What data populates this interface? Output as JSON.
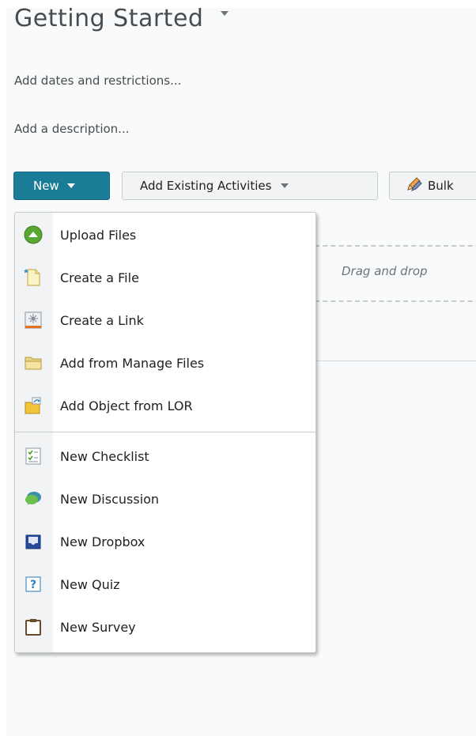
{
  "header": {
    "title": "Getting Started",
    "add_dates_link": "Add dates and restrictions...",
    "add_description_link": "Add a description..."
  },
  "toolbar": {
    "new_label": "New",
    "add_existing_label": "Add Existing Activities",
    "bulk_label": "Bulk"
  },
  "dropzone": {
    "text": "Drag and drop"
  },
  "new_menu": {
    "items": [
      {
        "label": "Upload Files",
        "icon": "upload-icon"
      },
      {
        "label": "Create a File",
        "icon": "file-icon"
      },
      {
        "label": "Create a Link",
        "icon": "link-icon"
      },
      {
        "label": "Add from Manage Files",
        "icon": "folder-icon"
      },
      {
        "label": "Add Object from LOR",
        "icon": "lor-object-icon"
      },
      {
        "label": "New Checklist",
        "icon": "checklist-icon"
      },
      {
        "label": "New Discussion",
        "icon": "discussion-icon"
      },
      {
        "label": "New Dropbox",
        "icon": "dropbox-icon"
      },
      {
        "label": "New Quiz",
        "icon": "quiz-icon"
      },
      {
        "label": "New Survey",
        "icon": "survey-icon"
      }
    ]
  },
  "colors": {
    "primary_button": "#1b7c98",
    "menu_icon_column": "#f1f3f4",
    "upload_green": "#5aa834",
    "dropbox_blue": "#274a9c",
    "discussion_teal": "#3f8fa6"
  }
}
